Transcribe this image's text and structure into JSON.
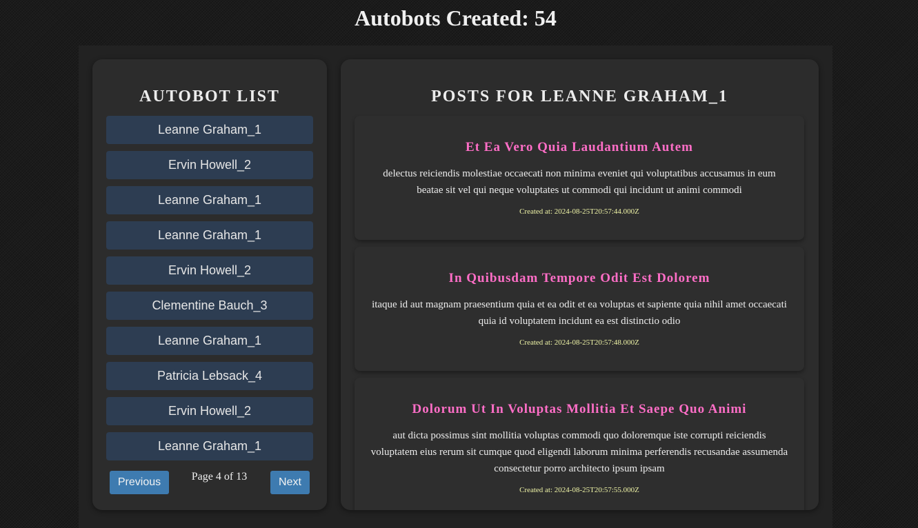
{
  "header": {
    "title": "Autobots Created: 54"
  },
  "sidebar": {
    "heading": "Autobot List",
    "items": [
      {
        "label": "Leanne Graham_1"
      },
      {
        "label": "Ervin Howell_2"
      },
      {
        "label": "Leanne Graham_1"
      },
      {
        "label": "Leanne Graham_1"
      },
      {
        "label": "Ervin Howell_2"
      },
      {
        "label": "Clementine Bauch_3"
      },
      {
        "label": "Leanne Graham_1"
      },
      {
        "label": "Patricia Lebsack_4"
      },
      {
        "label": "Ervin Howell_2"
      },
      {
        "label": "Leanne Graham_1"
      }
    ],
    "pagination": {
      "previous_label": "Previous",
      "next_label": "Next",
      "page_info": "Page 4 of 13"
    }
  },
  "main": {
    "heading": "Posts for Leanne Graham_1",
    "posts": [
      {
        "title": "Et Ea Vero Quia Laudantium Autem",
        "body": "delectus reiciendis molestiae occaecati non minima eveniet qui voluptatibus accusamus in eum beatae sit vel qui neque voluptates ut commodi qui incidunt ut animi commodi",
        "created": "Created at: 2024-08-25T20:57:44.000Z"
      },
      {
        "title": "In Quibusdam Tempore Odit Est Dolorem",
        "body": "itaque id aut magnam praesentium quia et ea odit et ea voluptas et sapiente quia nihil amet occaecati quia id voluptatem incidunt ea est distinctio odio",
        "created": "Created at: 2024-08-25T20:57:48.000Z"
      },
      {
        "title": "Dolorum Ut In Voluptas Mollitia Et Saepe Quo Animi",
        "body": "aut dicta possimus sint mollitia voluptas commodi quo doloremque iste corrupti reiciendis voluptatem eius rerum sit cumque quod eligendi laborum minima perferendis recusandae assumenda consectetur porro architecto ipsum ipsam",
        "created": "Created at: 2024-08-25T20:57:55.000Z"
      }
    ]
  },
  "colors": {
    "post_title": "#ff6ec7",
    "post_date": "#eef3a6",
    "list_item_bg": "#2d3d52",
    "button_bg": "#3e7bb0"
  }
}
